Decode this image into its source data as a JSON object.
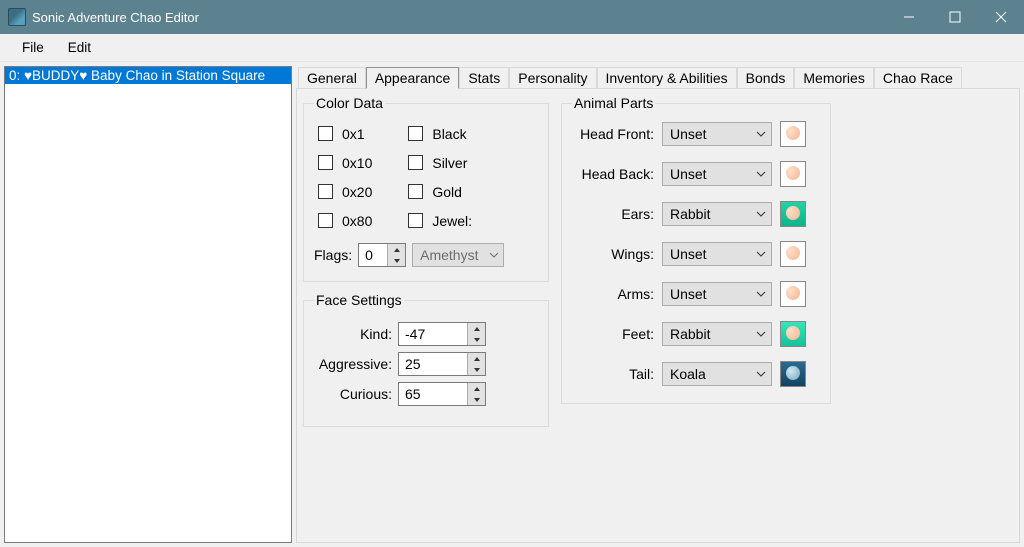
{
  "window": {
    "title": "Sonic Adventure Chao Editor"
  },
  "menu": {
    "file": "File",
    "edit": "Edit"
  },
  "list": {
    "items": [
      "0: ♥BUDDY♥ Baby Chao in Station Square"
    ]
  },
  "tabs": [
    "General",
    "Appearance",
    "Stats",
    "Personality",
    "Inventory & Abilities",
    "Bonds",
    "Memories",
    "Chao Race"
  ],
  "active_tab_index": 1,
  "color_data": {
    "legend": "Color Data",
    "left": [
      "0x1",
      "0x10",
      "0x20",
      "0x80"
    ],
    "right": [
      "Black",
      "Silver",
      "Gold",
      "Jewel:"
    ],
    "flags_label": "Flags:",
    "flags_value": "0",
    "jewel_dropdown": "Amethyst"
  },
  "face": {
    "legend": "Face Settings",
    "rows": [
      {
        "label": "Kind:",
        "value": "-47"
      },
      {
        "label": "Aggressive:",
        "value": "25"
      },
      {
        "label": "Curious:",
        "value": "65"
      }
    ]
  },
  "animal": {
    "legend": "Animal Parts",
    "rows": [
      {
        "label": "Head Front:",
        "value": "Unset",
        "thumb": "none"
      },
      {
        "label": "Head Back:",
        "value": "Unset",
        "thumb": "none"
      },
      {
        "label": "Ears:",
        "value": "Rabbit",
        "thumb": "rabbit"
      },
      {
        "label": "Wings:",
        "value": "Unset",
        "thumb": "none"
      },
      {
        "label": "Arms:",
        "value": "Unset",
        "thumb": "none"
      },
      {
        "label": "Feet:",
        "value": "Rabbit",
        "thumb": "rabbit2"
      },
      {
        "label": "Tail:",
        "value": "Koala",
        "thumb": "koala"
      }
    ]
  }
}
